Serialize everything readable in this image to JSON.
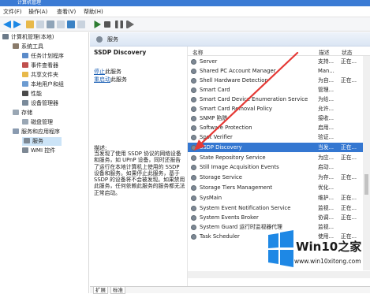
{
  "window": {
    "title": "计算机管理"
  },
  "menu": [
    "文件(F)",
    "操作(A)",
    "查看(V)",
    "帮助(H)"
  ],
  "tree": {
    "root": "计算机管理(本地)",
    "items": [
      {
        "label": "系统工具",
        "level": 1
      },
      {
        "label": "任务计划程序",
        "level": 2
      },
      {
        "label": "事件查看器",
        "level": 2
      },
      {
        "label": "共享文件夹",
        "level": 2
      },
      {
        "label": "本地用户和组",
        "level": 2
      },
      {
        "label": "性能",
        "level": 2
      },
      {
        "label": "设备管理器",
        "level": 2
      },
      {
        "label": "存储",
        "level": 1
      },
      {
        "label": "磁盘管理",
        "level": 2
      },
      {
        "label": "服务和应用程序",
        "level": 1
      },
      {
        "label": "服务",
        "level": 2,
        "selected": true
      },
      {
        "label": "WMI 控件",
        "level": 2
      }
    ]
  },
  "header": {
    "title": "服务"
  },
  "details": {
    "service_name": "SSDP Discovery",
    "stop_link": "停止",
    "stop_suffix": "此服务",
    "restart_link": "重启动",
    "restart_suffix": "此服务",
    "desc_label": "描述:",
    "desc_text": "当发现了使用 SSDP 协议的网络设备和服务，如 UPnP 设备，同时还报告了运行在本地计算机上使用的 SSDP 设备和服务。如果停止此服务，基于 SSDP 的设备将不会被发现。如果禁用此服务，任何依赖此服务的服务都无法正常启动。"
  },
  "list": {
    "columns": [
      "名称",
      "描述",
      "状态"
    ],
    "rows": [
      {
        "name": "Server",
        "desc": "支持...",
        "status": "正在..."
      },
      {
        "name": "Shared PC Account Manager",
        "desc": "Man...",
        "status": ""
      },
      {
        "name": "Shell Hardware Detection",
        "desc": "为自...",
        "status": "正在..."
      },
      {
        "name": "Smart Card",
        "desc": "管理...",
        "status": ""
      },
      {
        "name": "Smart Card Device Enumeration Service",
        "desc": "为给...",
        "status": ""
      },
      {
        "name": "Smart Card Removal Policy",
        "desc": "允许...",
        "status": ""
      },
      {
        "name": "SNMP 陷阱",
        "desc": "接收...",
        "status": ""
      },
      {
        "name": "Software Protection",
        "desc": "启用...",
        "status": ""
      },
      {
        "name": "Spot Verifier",
        "desc": "验证...",
        "status": ""
      },
      {
        "name": "SSDP Discovery",
        "desc": "当发...",
        "status": "正在...",
        "selected": true
      },
      {
        "name": "State Repository Service",
        "desc": "为应...",
        "status": "正在..."
      },
      {
        "name": "Still Image Acquisition Events",
        "desc": "启动...",
        "status": ""
      },
      {
        "name": "Storage Service",
        "desc": "为存...",
        "status": "正在..."
      },
      {
        "name": "Storage Tiers Management",
        "desc": "优化...",
        "status": ""
      },
      {
        "name": "SysMain",
        "desc": "维护...",
        "status": "正在..."
      },
      {
        "name": "System Event Notification Service",
        "desc": "监视...",
        "status": "正在..."
      },
      {
        "name": "System Events Broker",
        "desc": "协调...",
        "status": "正在..."
      },
      {
        "name": "System Guard 运行时监视器代理",
        "desc": "监视...",
        "status": ""
      },
      {
        "name": "Task Scheduler",
        "desc": "使用...",
        "status": "正在..."
      }
    ]
  },
  "tabs": [
    "扩展",
    "标准"
  ],
  "watermark": {
    "title": "Win10之家",
    "url": "www.win10xitong.com"
  },
  "colors": {
    "accent": "#3477d1",
    "logo": "#1e88e5",
    "arrow": "#e53935"
  }
}
